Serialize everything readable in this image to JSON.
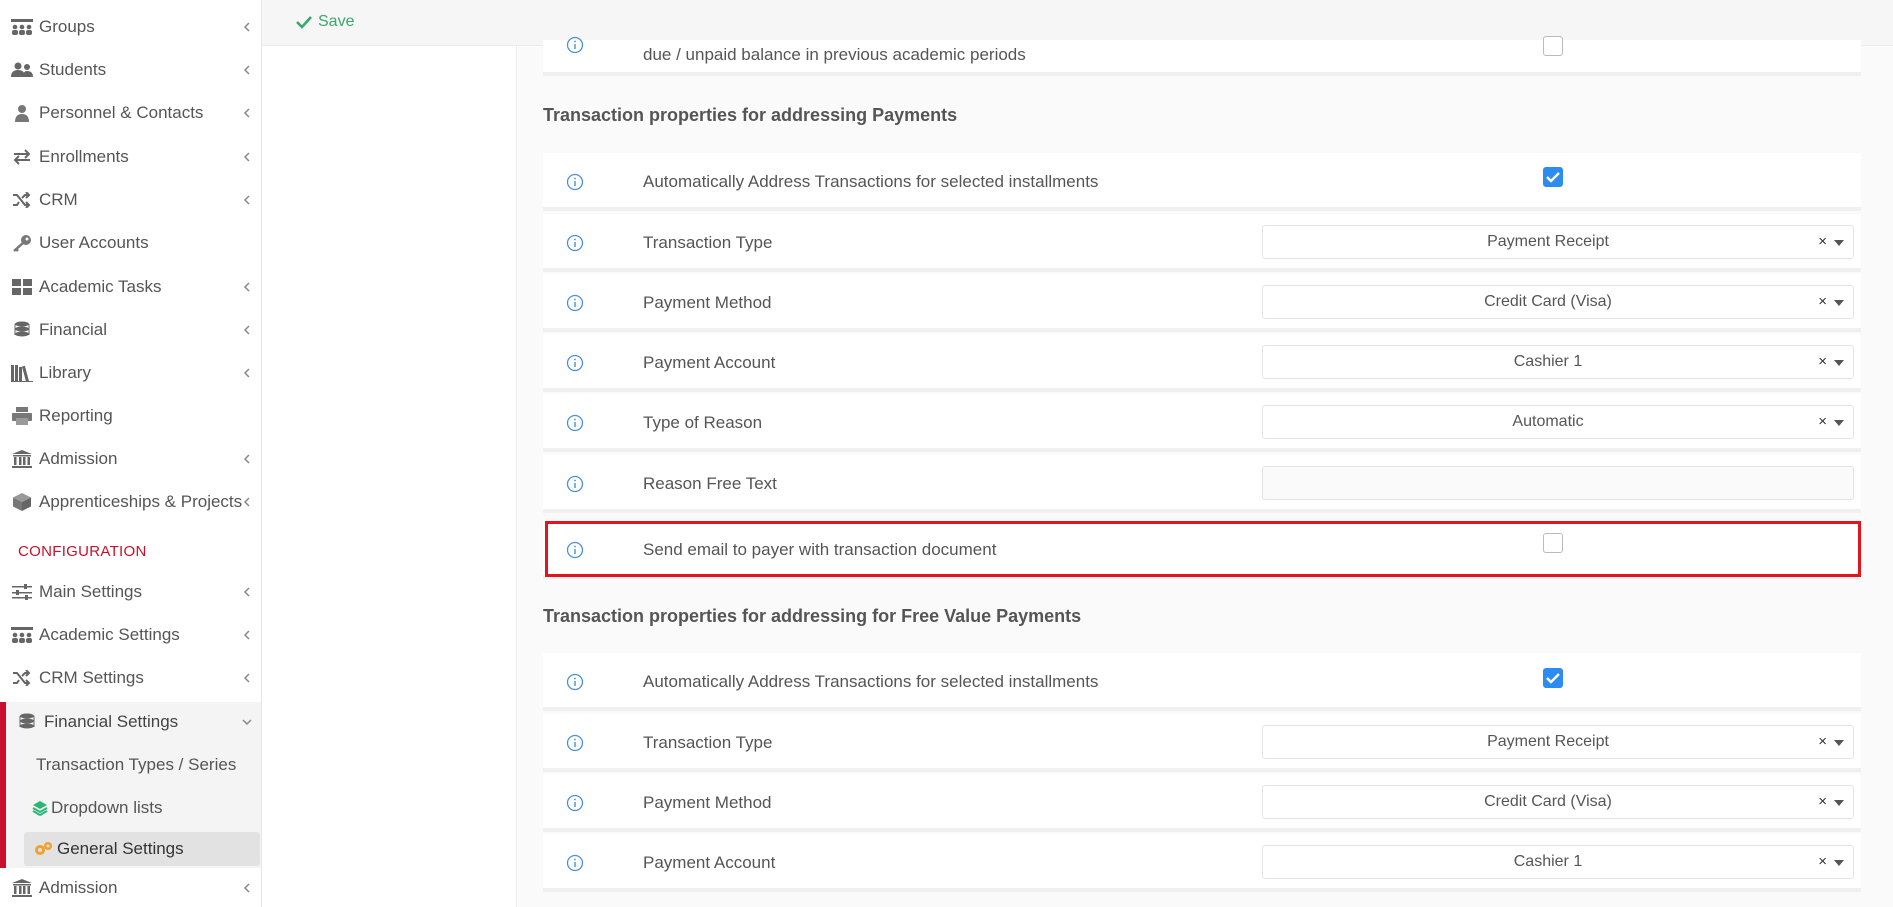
{
  "sidebar": {
    "items": [
      {
        "label": "Groups",
        "icon": "groups-icon",
        "chevron": true
      },
      {
        "label": "Students",
        "icon": "students-icon",
        "chevron": true
      },
      {
        "label": "Personnel & Contacts",
        "icon": "person-icon",
        "chevron": true
      },
      {
        "label": "Enrollments",
        "icon": "exchange-icon",
        "chevron": true
      },
      {
        "label": "CRM",
        "icon": "shuffle-icon",
        "chevron": true
      },
      {
        "label": "User Accounts",
        "icon": "key-icon",
        "chevron": false
      },
      {
        "label": "Academic Tasks",
        "icon": "dashboard-icon",
        "chevron": true
      },
      {
        "label": "Financial",
        "icon": "coins-icon",
        "chevron": true
      },
      {
        "label": "Library",
        "icon": "books-icon",
        "chevron": true
      },
      {
        "label": "Reporting",
        "icon": "printer-icon",
        "chevron": false
      },
      {
        "label": "Admission",
        "icon": "institution-icon",
        "chevron": true
      },
      {
        "label": "Apprenticeships & Projects",
        "icon": "cube-icon",
        "chevron": true
      }
    ],
    "config_label": "CONFIGURATION",
    "config_items": [
      {
        "label": "Main Settings",
        "icon": "sliders-icon",
        "chevron": true
      },
      {
        "label": "Academic Settings",
        "icon": "groups-icon",
        "chevron": true
      },
      {
        "label": "CRM Settings",
        "icon": "shuffle-icon",
        "chevron": true
      },
      {
        "label": "Financial Settings",
        "icon": "coins-icon",
        "chevron": "down"
      }
    ],
    "financial_sub": {
      "transaction_types": "Transaction Types / Series",
      "dropdown_lists": "Dropdown lists",
      "general_settings": "General Settings"
    },
    "admission_bottom": "Admission"
  },
  "topbar": {
    "save_label": "Save"
  },
  "content": {
    "partial_row_label": "due / unpaid balance in previous academic periods",
    "section1_title": "Transaction properties for addressing Payments",
    "section1_rows": [
      {
        "label": "Automatically Address Transactions for selected installments",
        "type": "checkbox",
        "checked": true
      },
      {
        "label": "Transaction Type",
        "type": "select",
        "value": "Payment Receipt"
      },
      {
        "label": "Payment Method",
        "type": "select",
        "value": "Credit Card (Visa)"
      },
      {
        "label": "Payment Account",
        "type": "select",
        "value": "Cashier 1"
      },
      {
        "label": "Type of Reason",
        "type": "select",
        "value": "Automatic"
      },
      {
        "label": "Reason Free Text",
        "type": "text",
        "value": ""
      },
      {
        "label": "Send email to payer with transaction document",
        "type": "checkbox",
        "checked": false
      }
    ],
    "section2_title": "Transaction properties for addressing for Free Value Payments",
    "section2_rows": [
      {
        "label": "Automatically Address Transactions for selected installments",
        "type": "checkbox",
        "checked": true
      },
      {
        "label": "Transaction Type",
        "type": "select",
        "value": "Payment Receipt"
      },
      {
        "label": "Payment Method",
        "type": "select",
        "value": "Credit Card (Visa)"
      },
      {
        "label": "Payment Account",
        "type": "select",
        "value": "Cashier 1"
      }
    ],
    "clear_symbol": "×"
  },
  "colors": {
    "accent_red": "#c8102e",
    "highlight_red": "#e3141b",
    "checkbox_blue": "#2d8cf0",
    "save_green": "#3aa76d",
    "info_blue": "#4a90d9"
  }
}
